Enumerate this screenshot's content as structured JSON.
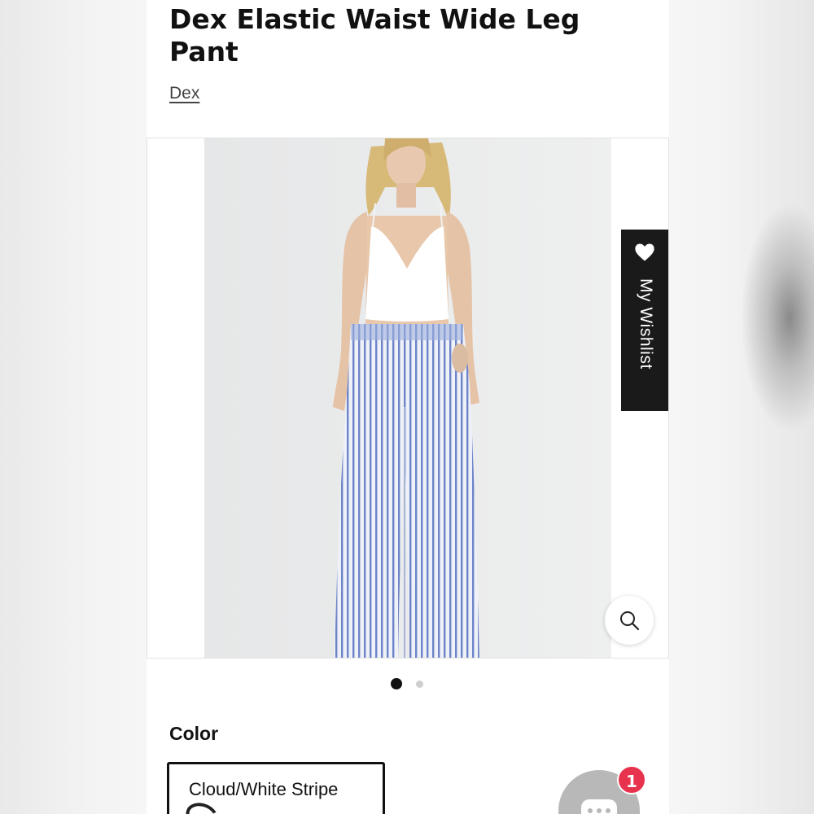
{
  "product": {
    "title": "Dex Elastic Waist Wide Leg Pant",
    "brand": "Dex"
  },
  "gallery": {
    "wishlist_label": "My Wishlist",
    "slide_count": 2,
    "active_slide": 1
  },
  "options": {
    "color_label": "Color",
    "selected_color": "Cloud/White Stripe"
  },
  "chat": {
    "badge_count": "1"
  },
  "colors": {
    "wishlist_bg": "#1a1a1a",
    "badge": "#e8334f",
    "stripe": "#6d84c9"
  },
  "icons": {
    "wishlist": "heart-icon",
    "zoom": "magnifier-icon",
    "chat": "chat-bubble-icon"
  }
}
